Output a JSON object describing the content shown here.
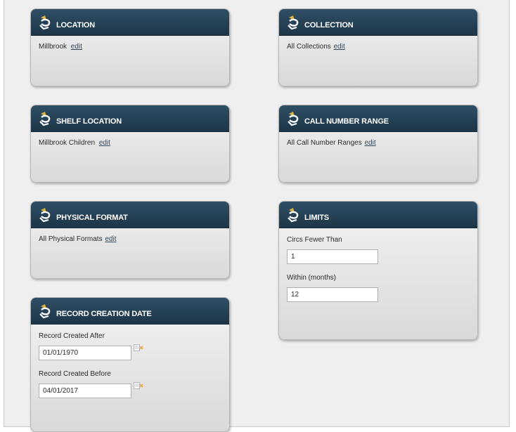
{
  "cards": {
    "location": {
      "title": "LOCATION",
      "value": "Millbrook",
      "edit": "edit"
    },
    "collection": {
      "title": "COLLECTION",
      "value": "All Collections",
      "edit": "edit"
    },
    "shelf_location": {
      "title": "SHELF LOCATION",
      "value": "Millbrook Children",
      "edit": "edit"
    },
    "call_number_range": {
      "title": "CALL NUMBER RANGE",
      "value": "All Call Number Ranges",
      "edit": "edit"
    },
    "physical_format": {
      "title": "PHYSICAL FORMAT",
      "value": "All Physical Formats",
      "edit": "edit"
    },
    "limits": {
      "title": "LIMITS",
      "circs_label": "Circs Fewer Than",
      "circs_value": "1",
      "within_label": "Within (months)",
      "within_value": "12"
    },
    "record_creation_date": {
      "title": "RECORD CREATION DATE",
      "after_label": "Record Created After",
      "after_value": "01/01/1970",
      "before_label": "Record Created Before",
      "before_value": "04/01/2017"
    }
  },
  "icons": {
    "card": "logo-icon",
    "calendar": "calendar-clear-icon"
  },
  "colors": {
    "header": "#1d3547",
    "accent": "#e0b43c",
    "link": "#33475b"
  }
}
